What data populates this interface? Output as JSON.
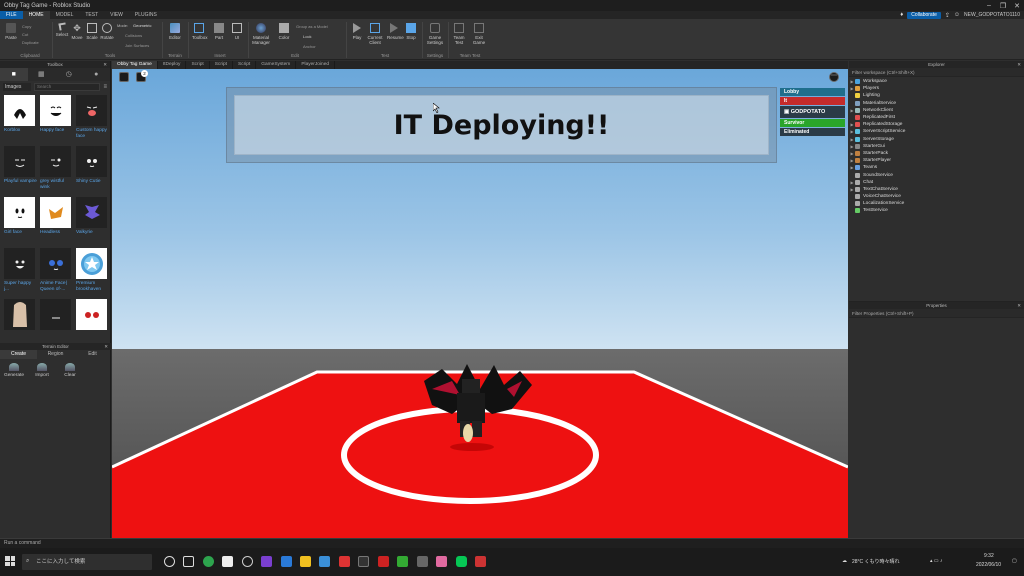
{
  "window": {
    "title": "Obby Tag Game - Roblox Studio"
  },
  "menu": {
    "tabs": [
      "FILE",
      "HOME",
      "MODEL",
      "TEST",
      "VIEW",
      "PLUGINS"
    ],
    "collaborate": "Collaborate",
    "user": "NEW_GODPOTATO1110"
  },
  "ribbon": {
    "clipboard": {
      "paste": "Paste",
      "copy": "Copy",
      "cut": "Cut",
      "duplicate": "Duplicate",
      "label": "Clipboard"
    },
    "tools": {
      "select": "Select",
      "move": "Move",
      "scale": "Scale",
      "rotate": "Rotate",
      "mode_label": "Mode:",
      "mode_value": "Geometric",
      "collisions": "Collisions",
      "join_surfaces": "Join Surfaces",
      "label": "Tools"
    },
    "terrain": {
      "editor": "Editor",
      "label": "Terrain"
    },
    "insert": {
      "toolbox": "Toolbox",
      "part": "Part",
      "ui": "UI",
      "label": "Insert"
    },
    "edit": {
      "material_manager": "Material Manager",
      "color": "Color",
      "group": "Group as a Model",
      "lock": "Lock",
      "anchor": "Anchor",
      "label": "Edit"
    },
    "test": {
      "play": "Play",
      "current_client": "Current Client",
      "resume": "Resume",
      "stop": "Stop",
      "label": "Test"
    },
    "settings": {
      "game_settings": "Game Settings",
      "label": "Settings"
    },
    "team_test": {
      "team_test": "Team Test",
      "exit_game": "Exit Game",
      "label": "Team Test"
    }
  },
  "toolbox": {
    "title": "Toolbox",
    "category": "Images",
    "search_placeholder": "Search",
    "items": [
      {
        "name": "Korblox"
      },
      {
        "name": "Happy face"
      },
      {
        "name": "Custom happy face"
      },
      {
        "name": "Playful vampire"
      },
      {
        "name": "grey wistful wink"
      },
      {
        "name": "Shiny Cutie"
      },
      {
        "name": "Girl face"
      },
      {
        "name": "Headless"
      },
      {
        "name": "Valkyrie"
      },
      {
        "name": "Super happy j..."
      },
      {
        "name": "Anime Face| Queen of-..."
      },
      {
        "name": "Premium brookhaven"
      },
      {
        "name": ""
      },
      {
        "name": ""
      },
      {
        "name": ""
      }
    ]
  },
  "terrain_editor": {
    "title": "Terrain Editor",
    "tabs": [
      "Create",
      "Region",
      "Edit"
    ],
    "tools": [
      "Generate",
      "Import",
      "Clear"
    ]
  },
  "doc_tabs": [
    "Obby Tag Game",
    "ItDeploy",
    "Script",
    "Script",
    "Script",
    "GameSystem",
    "PlayerJoined"
  ],
  "viewport": {
    "banner_text": "IT Deploying!!",
    "notification_count": "2",
    "teams": [
      {
        "label": "Lobby",
        "color": "#1f6e8c"
      },
      {
        "label": "It",
        "color": "#c42b2b"
      },
      {
        "label": "GODPOTATO",
        "color": "#2b3b47"
      },
      {
        "label": "Survivor",
        "color": "#2aa52a"
      },
      {
        "label": "Eliminated",
        "color": "#2b3b47"
      }
    ]
  },
  "explorer": {
    "title": "Explorer",
    "filter_placeholder": "Filter workspace (Ctrl+Shift+X)",
    "nodes": [
      {
        "label": "Workspace",
        "expandable": true,
        "color": "#4aa3df"
      },
      {
        "label": "Players",
        "expandable": true,
        "color": "#e0a040"
      },
      {
        "label": "Lighting",
        "expandable": false,
        "color": "#f0d040"
      },
      {
        "label": "MaterialService",
        "expandable": false,
        "color": "#7fa0c0"
      },
      {
        "label": "NetworkClient",
        "expandable": true,
        "color": "#9bb"
      },
      {
        "label": "ReplicatedFirst",
        "expandable": false,
        "color": "#e05050"
      },
      {
        "label": "ReplicatedStorage",
        "expandable": true,
        "color": "#e05050"
      },
      {
        "label": "ServerScriptService",
        "expandable": true,
        "color": "#5bc0de"
      },
      {
        "label": "ServerStorage",
        "expandable": true,
        "color": "#5bc0de"
      },
      {
        "label": "StarterGui",
        "expandable": true,
        "color": "#888"
      },
      {
        "label": "StarterPack",
        "expandable": true,
        "color": "#c08040"
      },
      {
        "label": "StarterPlayer",
        "expandable": true,
        "color": "#c08040"
      },
      {
        "label": "Teams",
        "expandable": true,
        "color": "#6aa0e0"
      },
      {
        "label": "SoundService",
        "expandable": false,
        "color": "#aaa"
      },
      {
        "label": "Chat",
        "expandable": true,
        "color": "#aaa"
      },
      {
        "label": "TextChatService",
        "expandable": true,
        "color": "#aaa"
      },
      {
        "label": "VoiceChatService",
        "expandable": false,
        "color": "#aaa"
      },
      {
        "label": "LocalizationService",
        "expandable": false,
        "color": "#aaa"
      },
      {
        "label": "TestService",
        "expandable": false,
        "color": "#6c6"
      }
    ]
  },
  "properties": {
    "title": "Properties",
    "filter_placeholder": "Filter Properties (Ctrl+Shift+P)"
  },
  "command_bar": {
    "placeholder": "Run a command"
  },
  "taskbar": {
    "search_placeholder": "ここに入力して検索",
    "weather": "28°C くもり時々晴れ",
    "time": "9:32",
    "date": "2022/06/10"
  }
}
